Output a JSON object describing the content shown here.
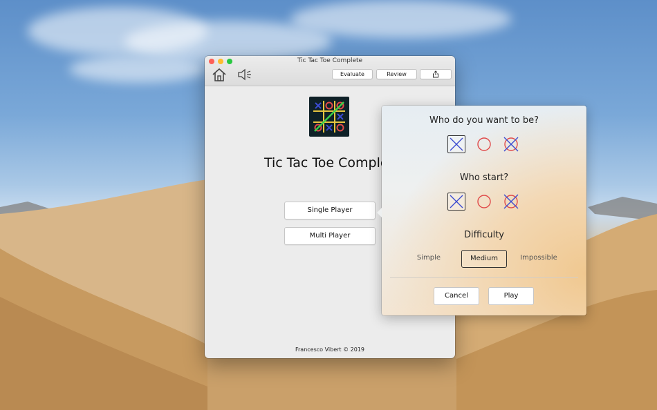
{
  "window": {
    "title": "Tic Tac Toe Complete",
    "toolbar": {
      "evaluate_label": "Evaluate",
      "review_label": "Review",
      "home_icon": "home-icon",
      "sound_icon": "speaker-icon",
      "share_icon": "share-icon"
    },
    "app_title": "Tic Tac Toe Complete",
    "single_player_label": "Single Player",
    "multi_player_label": "Multi Player",
    "footer": "Francesco Vibert © 2019"
  },
  "popover": {
    "who_be_heading": "Who do you want to be?",
    "who_be_options": [
      "x",
      "o",
      "random"
    ],
    "who_be_selected": "x",
    "who_start_heading": "Who start?",
    "who_start_options": [
      "x",
      "o",
      "random"
    ],
    "who_start_selected": "x",
    "difficulty_heading": "Difficulty",
    "difficulty_options": [
      "Simple",
      "Medium",
      "Impossible"
    ],
    "difficulty_selected": "Medium",
    "cancel_label": "Cancel",
    "play_label": "Play"
  },
  "colors": {
    "x_blue": "#3b4bd0",
    "o_red": "#e04a4a",
    "traffic_red": "#fe5f57",
    "traffic_yellow": "#febc2e",
    "traffic_green": "#28c840"
  }
}
